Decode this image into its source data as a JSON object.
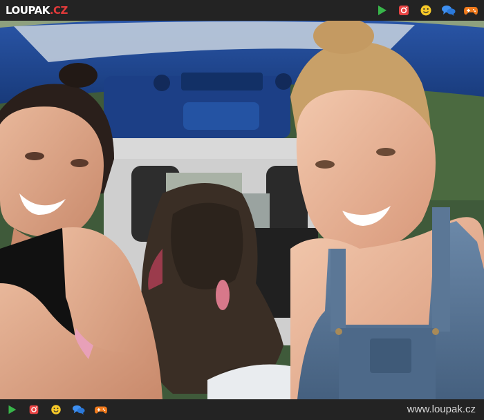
{
  "header": {
    "logo_main": "LOUPAK",
    "logo_tld": ".CZ",
    "icons": [
      "play-icon",
      "instagram-icon",
      "smiley-icon",
      "chat-icon",
      "gamepad-icon"
    ]
  },
  "footer": {
    "url": "www.loupak.cz",
    "icons": [
      "play-icon",
      "instagram-icon",
      "smiley-icon",
      "chat-icon",
      "gamepad-icon"
    ]
  },
  "colors": {
    "bar": "#232323",
    "play": "#38b54a",
    "instagram": "#e84444",
    "smiley": "#f7c928",
    "chat": "#3e8ff0",
    "gamepad": "#f07a1c",
    "logo_accent": "#e23a3a"
  }
}
